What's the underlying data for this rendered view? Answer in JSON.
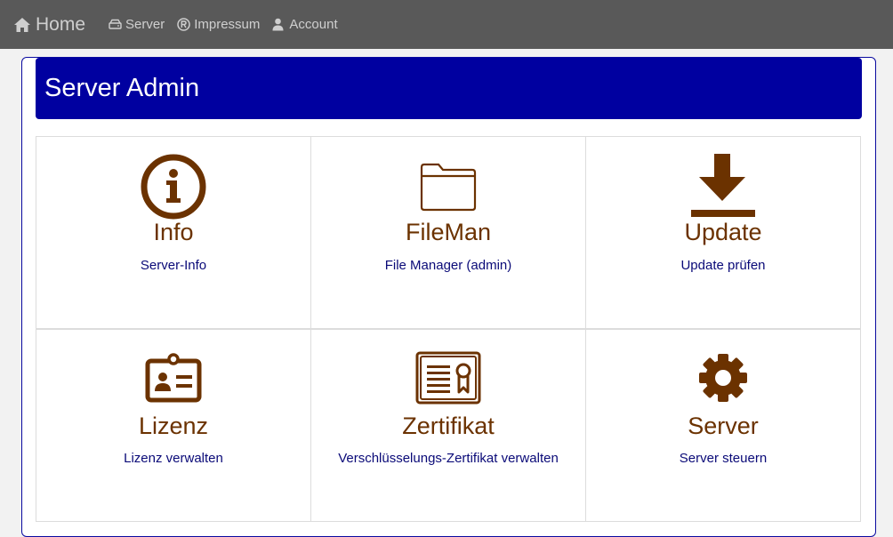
{
  "nav": {
    "brand_label": "Home",
    "brand_icon": "home-icon",
    "links": [
      {
        "label": "Server",
        "icon": "hdd-icon"
      },
      {
        "label": "Impressum",
        "icon": "registered-icon"
      },
      {
        "label": "Account",
        "icon": "user-icon"
      }
    ]
  },
  "page": {
    "title": "Server Admin"
  },
  "tiles": [
    {
      "title": "Info",
      "subtitle": "Server-Info",
      "icon": "info-circle-icon"
    },
    {
      "title": "FileMan",
      "subtitle": "File Manager (admin)",
      "icon": "folder-icon"
    },
    {
      "title": "Update",
      "subtitle": "Update prüfen",
      "icon": "download-icon"
    },
    {
      "title": "Lizenz",
      "subtitle": "Lizenz verwalten",
      "icon": "id-badge-icon"
    },
    {
      "title": "Zertifikat",
      "subtitle": "Verschlüsselungs-Zertifikat verwalten",
      "icon": "certificate-icon"
    },
    {
      "title": "Server",
      "subtitle": "Server steuern",
      "icon": "gear-icon"
    }
  ],
  "colors": {
    "navbar": "#595959",
    "header": "#0000a0",
    "tile_title": "#6b3200",
    "tile_subtitle": "#0a0a78"
  }
}
